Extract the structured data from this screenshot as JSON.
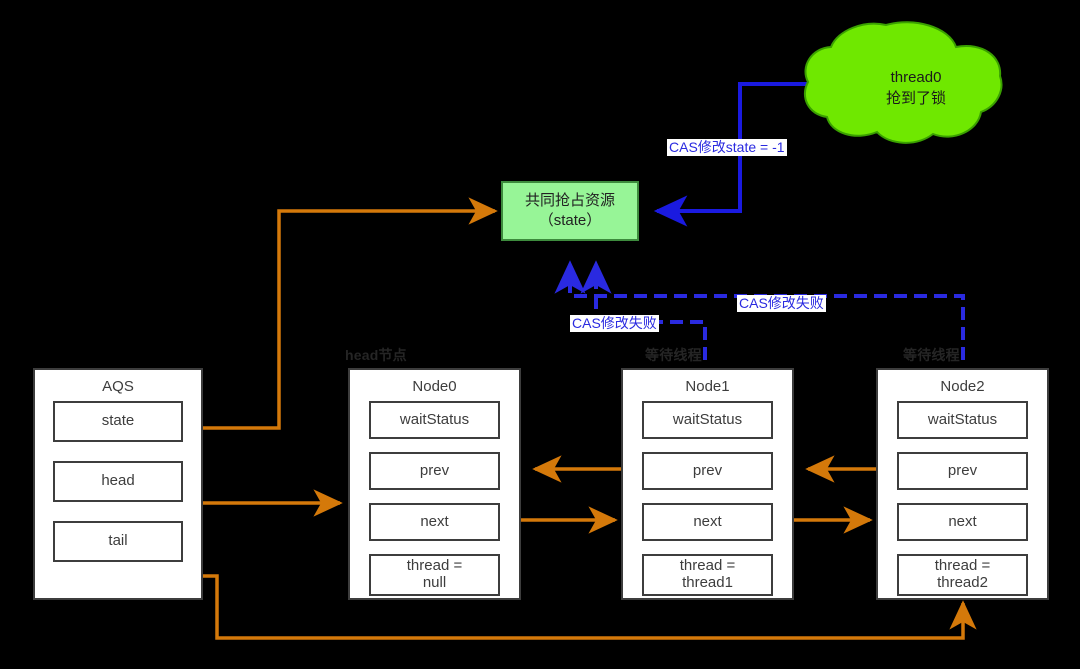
{
  "diagram": {
    "title": "AQS CLH queue with CAS state contention",
    "colors": {
      "background": "#000000",
      "resource_fill": "#97f597",
      "resource_stroke": "#3d8b3d",
      "cloud_fill": "#6fe800",
      "cloud_stroke": "#3aa000",
      "cas_success_line": "#1a1ae0",
      "cas_fail_line": "#2a2ae0",
      "pointer_line": "#d4790a",
      "box_stroke": "#3d3d3d",
      "box_fill": "#ffffff",
      "label_text": "#2a2ae0",
      "gray_caption": "#252525"
    }
  },
  "cloud": {
    "name": "thread0-cloud",
    "line1": "thread0",
    "line2": "抢到了锁"
  },
  "resource": {
    "name": "shared-resource-box",
    "line1": "共同抢占资源",
    "line2": "（state）"
  },
  "edge_labels": {
    "cas_success": "CAS修改state = -1",
    "cas_fail_left": "CAS修改失败",
    "cas_fail_right": "CAS修改失败"
  },
  "captions": {
    "head_node": "head节点",
    "waiting_thread_1": "等待线程",
    "waiting_thread_2": "等待线程"
  },
  "aqs": {
    "title": "AQS",
    "fields": [
      {
        "label": "state"
      },
      {
        "label": "head"
      },
      {
        "label": "tail"
      }
    ]
  },
  "nodes": [
    {
      "title": "Node0",
      "fields": [
        {
          "label": "waitStatus"
        },
        {
          "label": "prev"
        },
        {
          "label": "next"
        },
        {
          "label": "thread =\nnull"
        }
      ]
    },
    {
      "title": "Node1",
      "fields": [
        {
          "label": "waitStatus"
        },
        {
          "label": "prev"
        },
        {
          "label": "next"
        },
        {
          "label": "thread =\nthread1"
        }
      ]
    },
    {
      "title": "Node2",
      "fields": [
        {
          "label": "waitStatus"
        },
        {
          "label": "prev"
        },
        {
          "label": "next"
        },
        {
          "label": "thread =\nthread2"
        }
      ]
    }
  ]
}
